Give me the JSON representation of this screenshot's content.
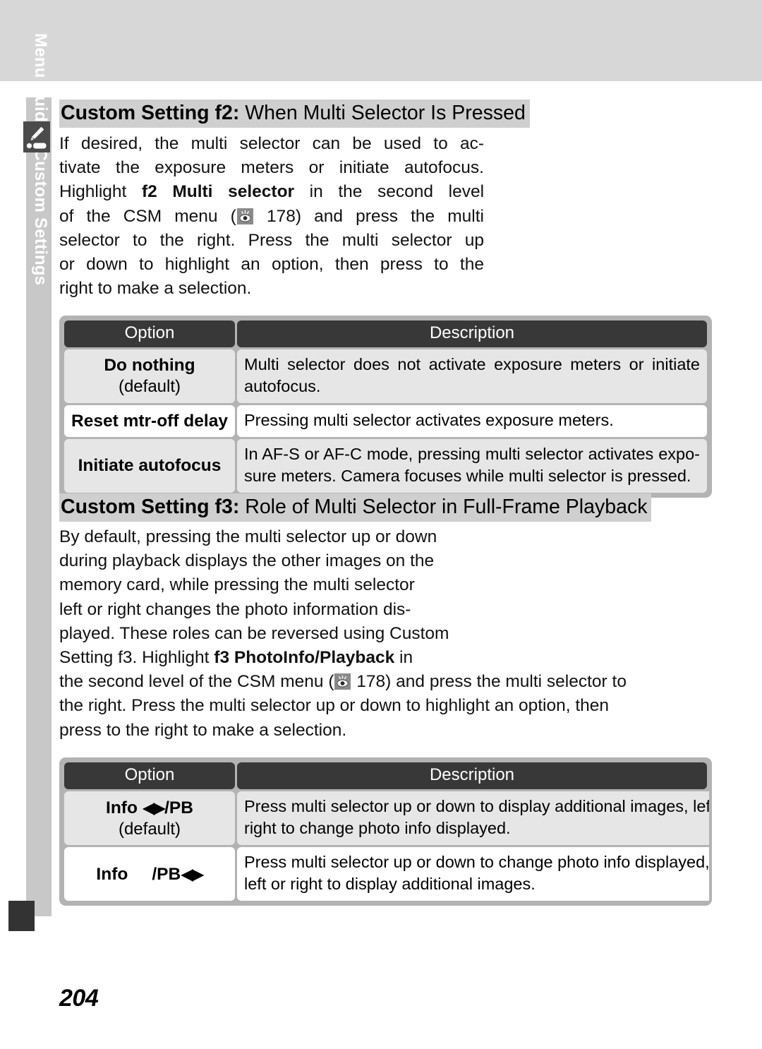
{
  "page": {
    "number": "204",
    "side_tab_label": "Menu Guide—Custom Settings"
  },
  "section_f2": {
    "heading_bold": "Custom Setting f2:",
    "heading_rest": " When Multi Selector Is Pressed",
    "paragraph_lines": [
      "If desired, the multi selector can be used to ac-",
      "tivate the exposure meters or initiate autofocus.",
      "HIGHLIGHT_LINE",
      "of the CSM menu (REF 178) and press the multi",
      "selector to the right.  Press the multi selector up",
      "or down to highlight an option, then press to the",
      "right to make a selection."
    ],
    "line3_a": "Highlight ",
    "line3_bold": "f2 Multi selector",
    "line3_b": " in the second level",
    "line4_a": "of the CSM menu (",
    "line4_b": " 178) and press the multi",
    "ref_page": "178",
    "table": {
      "headers": [
        "Option",
        "Description"
      ],
      "rows": [
        {
          "option": "Do nothing",
          "option_sub": "(default)",
          "description_lines": [
            "Multi selector does not activate exposure meters or initiate",
            "autofocus."
          ]
        },
        {
          "option": "Reset mtr-off delay",
          "option_sub": "",
          "description_lines": [
            "Pressing multi selector activates exposure meters."
          ]
        },
        {
          "option": "Initiate autofocus",
          "option_sub": "",
          "description_lines": [
            "In AF-S or AF-C mode, pressing multi selector activates expo-",
            "sure meters.  Camera focuses while multi selector is pressed."
          ]
        }
      ]
    }
  },
  "section_f3": {
    "heading_bold": "Custom Setting f3:",
    "heading_rest": " Role of Multi Selector in Full-Frame Playback",
    "paragraph_lines": [
      "By default, pressing the multi selector up or down",
      "during playback displays the other images on the",
      "memory card, while pressing the multi selector",
      "left or right changes the photo information dis-",
      "played.  These roles can be reversed using Custom",
      "SETTING_LINE",
      "REF_LINE",
      "the right.  Press the multi selector up or down to highlight an option, then",
      "press to the right to make a selection."
    ],
    "line6_a": "Setting f3.  Highlight ",
    "line6_bold": "f3 PhotoInfo/Playback",
    "line6_b": " in",
    "line7_a": "the second level of the CSM menu (",
    "line7_b": " 178) and press the multi selector to",
    "ref_page": "178",
    "table": {
      "headers": [
        "Option",
        "Description"
      ],
      "rows": [
        {
          "option_prefix": "Info ",
          "option_arrows": "◀▶",
          "option_suffix": "/PB",
          "option_sub": "(default)",
          "description_lines": [
            "Press multi selector up or down to display additional images, left or",
            "right to change photo info displayed."
          ]
        },
        {
          "option_prefix": "Info",
          "option_arrows": "◀▶",
          "option_suffix": "/PB",
          "option_sub": "",
          "description_lines": [
            "Press multi selector up or down to change photo info displayed,",
            "left or right to display additional images."
          ]
        }
      ]
    }
  },
  "icons": {
    "side_tab": "pencil-icon",
    "reference": "eye-reference-icon"
  }
}
